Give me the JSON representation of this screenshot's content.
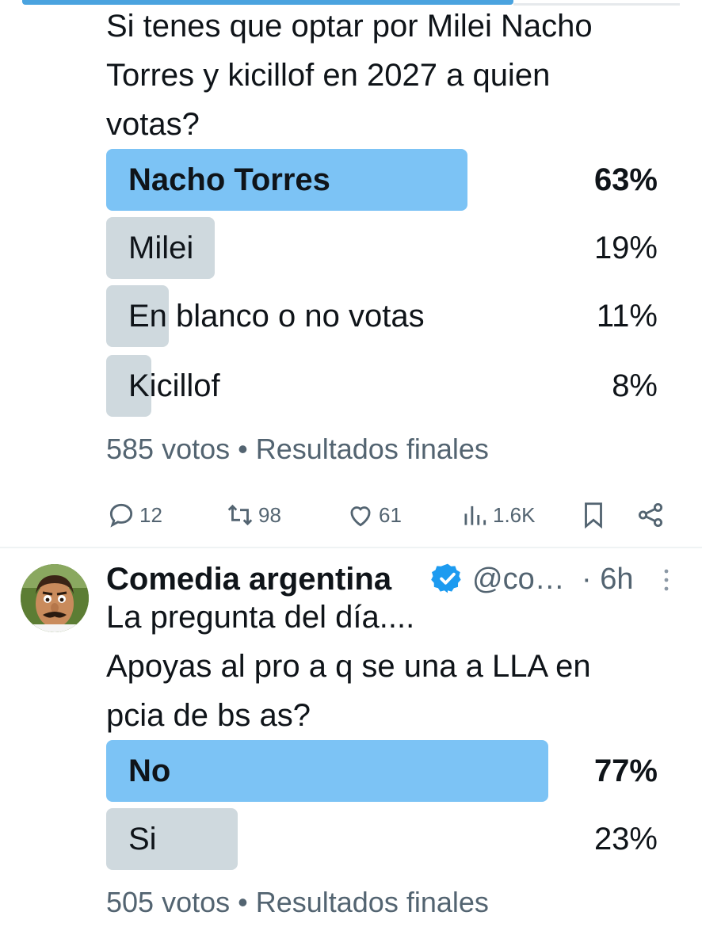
{
  "tweet1": {
    "text_lines": [
      "Si tenes que optar por Milei  Nacho",
      "Torres y kicillof en 2027 a quien",
      "votas?"
    ],
    "poll": [
      {
        "label": "Nacho Torres",
        "percent_text": "63%",
        "fraction": 0.63,
        "winner": true
      },
      {
        "label": "Milei",
        "percent_text": "19%",
        "fraction": 0.19,
        "winner": false
      },
      {
        "label": "En blanco o no votas",
        "percent_text": "11%",
        "fraction": 0.11,
        "winner": false
      },
      {
        "label": "Kicillof",
        "percent_text": "8%",
        "fraction": 0.08,
        "winner": false
      }
    ],
    "meta": "585 votos • Resultados finales",
    "actions": {
      "replies": "12",
      "reposts": "98",
      "likes": "61",
      "views": "1.6K"
    },
    "icons": [
      "reply-icon",
      "repost-icon",
      "like-icon",
      "views-icon",
      "bookmark-icon",
      "share-icon"
    ]
  },
  "tweet2": {
    "author": {
      "name": "Comedia argentina",
      "handle": "@co…",
      "time": "· 6h",
      "verified": true
    },
    "text_lines": [
      "La pregunta del día....",
      "Apoyas al pro a q se una a LLA en",
      "pcia de bs as?"
    ],
    "poll": [
      {
        "label": "No",
        "percent_text": "77%",
        "fraction": 0.77,
        "winner": true
      },
      {
        "label": "Si",
        "percent_text": "23%",
        "fraction": 0.23,
        "winner": false
      }
    ],
    "meta": "505 votos • Resultados finales"
  },
  "colors": {
    "winner_bar": "#7cc3f5",
    "loser_bar": "#cfd9de",
    "muted_text": "#536471",
    "verified": "#1d9bf0"
  }
}
